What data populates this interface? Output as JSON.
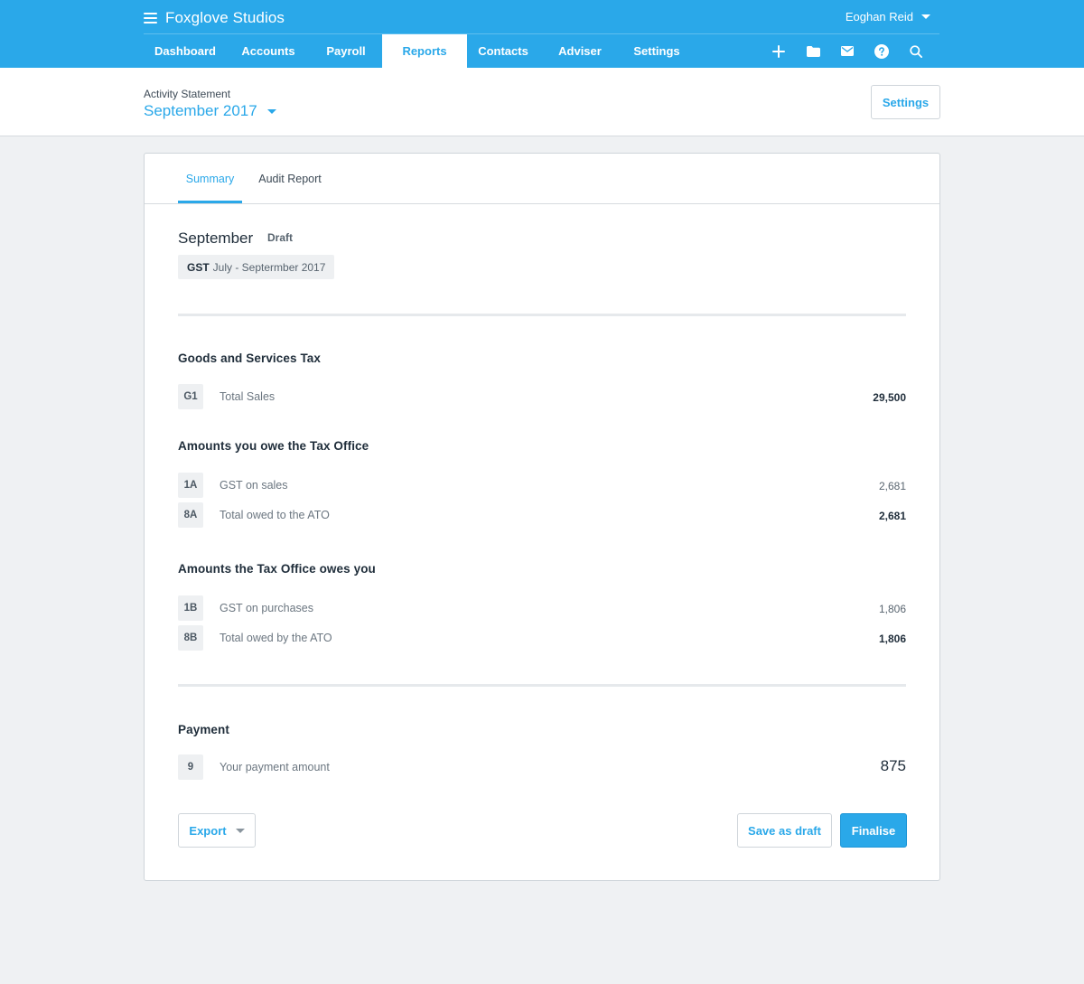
{
  "app": {
    "org_name": "Foxglove Studios",
    "user_name": "Eoghan Reid"
  },
  "nav": {
    "items": [
      {
        "label": "Dashboard"
      },
      {
        "label": "Accounts"
      },
      {
        "label": "Payroll"
      },
      {
        "label": "Reports",
        "active": true
      },
      {
        "label": "Contacts"
      },
      {
        "label": "Adviser"
      },
      {
        "label": "Settings"
      }
    ],
    "icons": [
      "plus-icon",
      "folder-icon",
      "mail-icon",
      "help-icon",
      "search-icon"
    ]
  },
  "header": {
    "breadcrumb": "Activity Statement",
    "period": "September 2017",
    "settings_label": "Settings"
  },
  "tabs": [
    {
      "label": "Summary",
      "active": true
    },
    {
      "label": "Audit Report",
      "active": false
    }
  ],
  "statement": {
    "title": "September",
    "status": "Draft",
    "chip_tax": "GST",
    "chip_period": "July - Septermber 2017"
  },
  "sections": {
    "gst": {
      "title": "Goods and Services Tax",
      "rows": [
        {
          "code": "G1",
          "label": "Total Sales",
          "value": "29,500"
        }
      ]
    },
    "owe": {
      "title": "Amounts you owe the Tax Office",
      "rows": [
        {
          "code": "1A",
          "label": "GST on sales",
          "value": "2,681"
        },
        {
          "code": "8A",
          "label": "Total owed to the ATO",
          "value": "2,681"
        }
      ]
    },
    "owed": {
      "title": "Amounts the Tax Office owes you",
      "rows": [
        {
          "code": "1B",
          "label": "GST on purchases",
          "value": "1,806"
        },
        {
          "code": "8B",
          "label": "Total owed by the ATO",
          "value": "1,806"
        }
      ]
    },
    "payment": {
      "title": "Payment",
      "rows": [
        {
          "code": "9",
          "label": "Your payment amount",
          "value": "875"
        }
      ]
    }
  },
  "actions": {
    "export_label": "Export",
    "save_draft_label": "Save as draft",
    "finalise_label": "Finalise"
  },
  "colors": {
    "brand_blue": "#2aa8e9",
    "page_bg": "#eff1f3",
    "text_dark": "#1f2d3a"
  }
}
